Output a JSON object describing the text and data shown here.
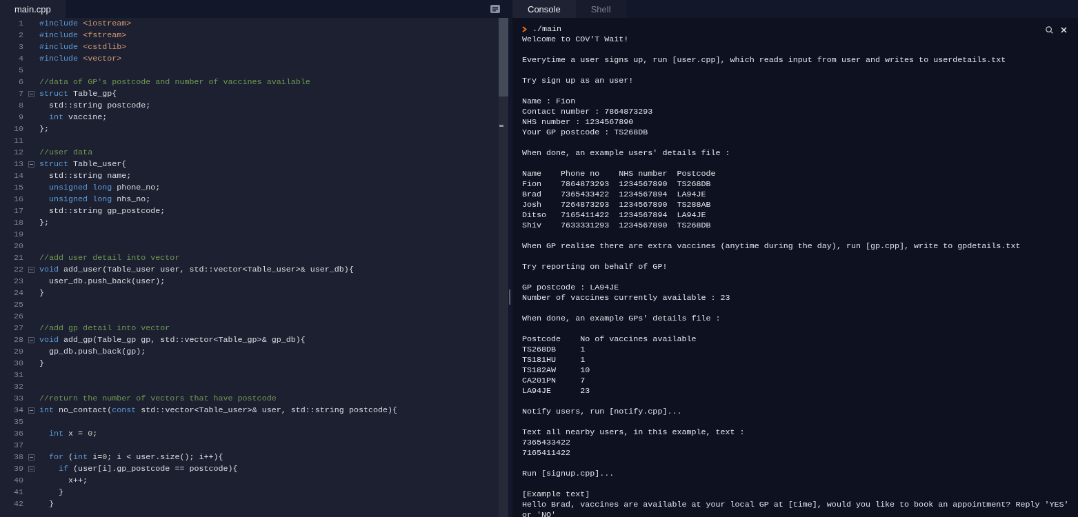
{
  "editor": {
    "tabs": [
      {
        "label": "main.cpp",
        "selected": true
      }
    ],
    "lines": [
      {
        "number": "1",
        "fold": false,
        "tokens": [
          {
            "text": "#include ",
            "kind": "preproc"
          },
          {
            "text": "<iostream>",
            "kind": "string"
          }
        ]
      },
      {
        "number": "2",
        "fold": false,
        "tokens": [
          {
            "text": "#include ",
            "kind": "preproc"
          },
          {
            "text": "<fstream>",
            "kind": "string"
          }
        ]
      },
      {
        "number": "3",
        "fold": false,
        "tokens": [
          {
            "text": "#include ",
            "kind": "preproc"
          },
          {
            "text": "<cstdlib>",
            "kind": "string"
          }
        ]
      },
      {
        "number": "4",
        "fold": false,
        "tokens": [
          {
            "text": "#include ",
            "kind": "preproc"
          },
          {
            "text": "<vector>",
            "kind": "string"
          }
        ]
      },
      {
        "number": "5",
        "fold": false
      },
      {
        "number": "6",
        "fold": false,
        "tokens": [
          {
            "text": "//data of GP's postcode and number of vaccines available",
            "kind": "comment"
          }
        ]
      },
      {
        "number": "7",
        "fold": true,
        "tokens": [
          {
            "text": "struct ",
            "kind": "keyword"
          },
          {
            "text": "Table_gp{",
            "kind": "plain"
          }
        ]
      },
      {
        "number": "8",
        "fold": false,
        "tokens": [
          {
            "text": "  std::string postcode;",
            "kind": "plain"
          }
        ]
      },
      {
        "number": "9",
        "fold": false,
        "tokens": [
          {
            "text": "  int ",
            "kind": "keyword"
          },
          {
            "text": "vaccine;",
            "kind": "plain"
          }
        ]
      },
      {
        "number": "10",
        "fold": false,
        "tokens": [
          {
            "text": "};",
            "kind": "plain"
          }
        ]
      },
      {
        "number": "11",
        "fold": false
      },
      {
        "number": "12",
        "fold": false,
        "tokens": [
          {
            "text": "//user data",
            "kind": "comment"
          }
        ]
      },
      {
        "number": "13",
        "fold": true,
        "tokens": [
          {
            "text": "struct ",
            "kind": "keyword"
          },
          {
            "text": "Table_user{",
            "kind": "plain"
          }
        ]
      },
      {
        "number": "14",
        "fold": false,
        "tokens": [
          {
            "text": "  std::string name;",
            "kind": "plain"
          }
        ]
      },
      {
        "number": "15",
        "fold": false,
        "tokens": [
          {
            "text": "  unsigned long ",
            "kind": "keyword"
          },
          {
            "text": "phone_no;",
            "kind": "plain"
          }
        ]
      },
      {
        "number": "16",
        "fold": false,
        "tokens": [
          {
            "text": "  unsigned long ",
            "kind": "keyword"
          },
          {
            "text": "nhs_no;",
            "kind": "plain"
          }
        ]
      },
      {
        "number": "17",
        "fold": false,
        "tokens": [
          {
            "text": "  std::string gp_postcode;",
            "kind": "plain"
          }
        ]
      },
      {
        "number": "18",
        "fold": false,
        "tokens": [
          {
            "text": "};",
            "kind": "plain"
          }
        ]
      },
      {
        "number": "19",
        "fold": false
      },
      {
        "number": "20",
        "fold": false
      },
      {
        "number": "21",
        "fold": false,
        "tokens": [
          {
            "text": "//add user detail into vector",
            "kind": "comment"
          }
        ]
      },
      {
        "number": "22",
        "fold": true,
        "tokens": [
          {
            "text": "void ",
            "kind": "keyword"
          },
          {
            "text": "add_user(Table_user user, std::vector<Table_user>& user_db){",
            "kind": "plain"
          }
        ]
      },
      {
        "number": "23",
        "fold": false,
        "tokens": [
          {
            "text": "  user_db.push_back(user);",
            "kind": "plain"
          }
        ]
      },
      {
        "number": "24",
        "fold": false,
        "tokens": [
          {
            "text": "}",
            "kind": "plain"
          }
        ]
      },
      {
        "number": "25",
        "fold": false
      },
      {
        "number": "26",
        "fold": false
      },
      {
        "number": "27",
        "fold": false,
        "tokens": [
          {
            "text": "//add gp detail into vector",
            "kind": "comment"
          }
        ]
      },
      {
        "number": "28",
        "fold": true,
        "tokens": [
          {
            "text": "void ",
            "kind": "keyword"
          },
          {
            "text": "add_gp(Table_gp gp, std::vector<Table_gp>& gp_db){",
            "kind": "plain"
          }
        ]
      },
      {
        "number": "29",
        "fold": false,
        "tokens": [
          {
            "text": "  gp_db.push_back(gp);",
            "kind": "plain"
          }
        ]
      },
      {
        "number": "30",
        "fold": false,
        "tokens": [
          {
            "text": "}",
            "kind": "plain"
          }
        ]
      },
      {
        "number": "31",
        "fold": false
      },
      {
        "number": "32",
        "fold": false
      },
      {
        "number": "33",
        "fold": false,
        "tokens": [
          {
            "text": "//return the number of vectors that have postcode",
            "kind": "comment"
          }
        ]
      },
      {
        "number": "34",
        "fold": true,
        "tokens": [
          {
            "text": "int ",
            "kind": "keyword"
          },
          {
            "text": "no_contact(",
            "kind": "plain"
          },
          {
            "text": "const ",
            "kind": "keyword"
          },
          {
            "text": "std::vector<Table_user>& user, std::string postcode){",
            "kind": "plain"
          }
        ]
      },
      {
        "number": "35",
        "fold": false
      },
      {
        "number": "36",
        "fold": false,
        "tokens": [
          {
            "text": "  int ",
            "kind": "keyword"
          },
          {
            "text": "x = ",
            "kind": "plain"
          },
          {
            "text": "0",
            "kind": "number"
          },
          {
            "text": ";",
            "kind": "plain"
          }
        ]
      },
      {
        "number": "37",
        "fold": false
      },
      {
        "number": "38",
        "fold": true,
        "tokens": [
          {
            "text": "  for ",
            "kind": "keyword"
          },
          {
            "text": "(",
            "kind": "plain"
          },
          {
            "text": "int ",
            "kind": "keyword"
          },
          {
            "text": "i=",
            "kind": "plain"
          },
          {
            "text": "0",
            "kind": "number"
          },
          {
            "text": "; i < user.size(); i++){",
            "kind": "plain"
          }
        ]
      },
      {
        "number": "39",
        "fold": true,
        "tokens": [
          {
            "text": "    if ",
            "kind": "keyword"
          },
          {
            "text": "(user[i].gp_postcode == postcode){",
            "kind": "plain"
          }
        ]
      },
      {
        "number": "40",
        "fold": false,
        "tokens": [
          {
            "text": "      x++;",
            "kind": "plain"
          }
        ]
      },
      {
        "number": "41",
        "fold": false,
        "tokens": [
          {
            "text": "    }",
            "kind": "plain"
          }
        ]
      },
      {
        "number": "42",
        "fold": false,
        "tokens": [
          {
            "text": "  }",
            "kind": "plain"
          }
        ]
      }
    ]
  },
  "console": {
    "tabs": [
      {
        "label": "Console",
        "selected": true
      },
      {
        "label": "Shell",
        "selected": false
      }
    ],
    "command": "./main",
    "blocks": [
      [
        "Welcome to COV'T Wait!"
      ],
      [
        "Everytime a user signs up, run [user.cpp], which reads input from user and writes to userdetails.txt"
      ],
      [
        "Try sign up as an user!"
      ],
      [
        "Name : Fion",
        "Contact number : 7864873293",
        "NHS number : 1234567890",
        "Your GP postcode : TS268DB"
      ],
      [
        "When done, an example users' details file :"
      ],
      [
        "Name    Phone no    NHS number  Postcode",
        "Fion    7864873293  1234567890  TS268DB",
        "Brad    7365433422  1234567894  LA94JE",
        "Josh    7264873293  1234567890  TS288AB",
        "Ditso   7165411422  1234567894  LA94JE",
        "Shiv    7633331293  1234567890  TS268DB"
      ],
      [
        "When GP realise there are extra vaccines (anytime during the day), run [gp.cpp], write to gpdetails.txt"
      ],
      [
        "Try reporting on behalf of GP!"
      ],
      [
        "GP postcode : LA94JE",
        "Number of vaccines currently available : 23"
      ],
      [
        "When done, an example GPs' details file :"
      ],
      [
        "Postcode    No of vaccines available",
        "TS268DB     1",
        "TS181HU     1",
        "TS182AW     10",
        "CA201PN     7",
        "LA94JE      23"
      ],
      [
        "Notify users, run [notify.cpp]..."
      ],
      [
        "Text all nearby users, in this example, text :",
        "7365433422",
        "7165411422"
      ],
      [
        "Run [signup.cpp]..."
      ],
      [
        "[Example text]",
        "Hello Brad, vaccines are available at your local GP at [time], would you like to book an appointment? Reply 'YES'",
        "or 'NO'"
      ]
    ]
  }
}
